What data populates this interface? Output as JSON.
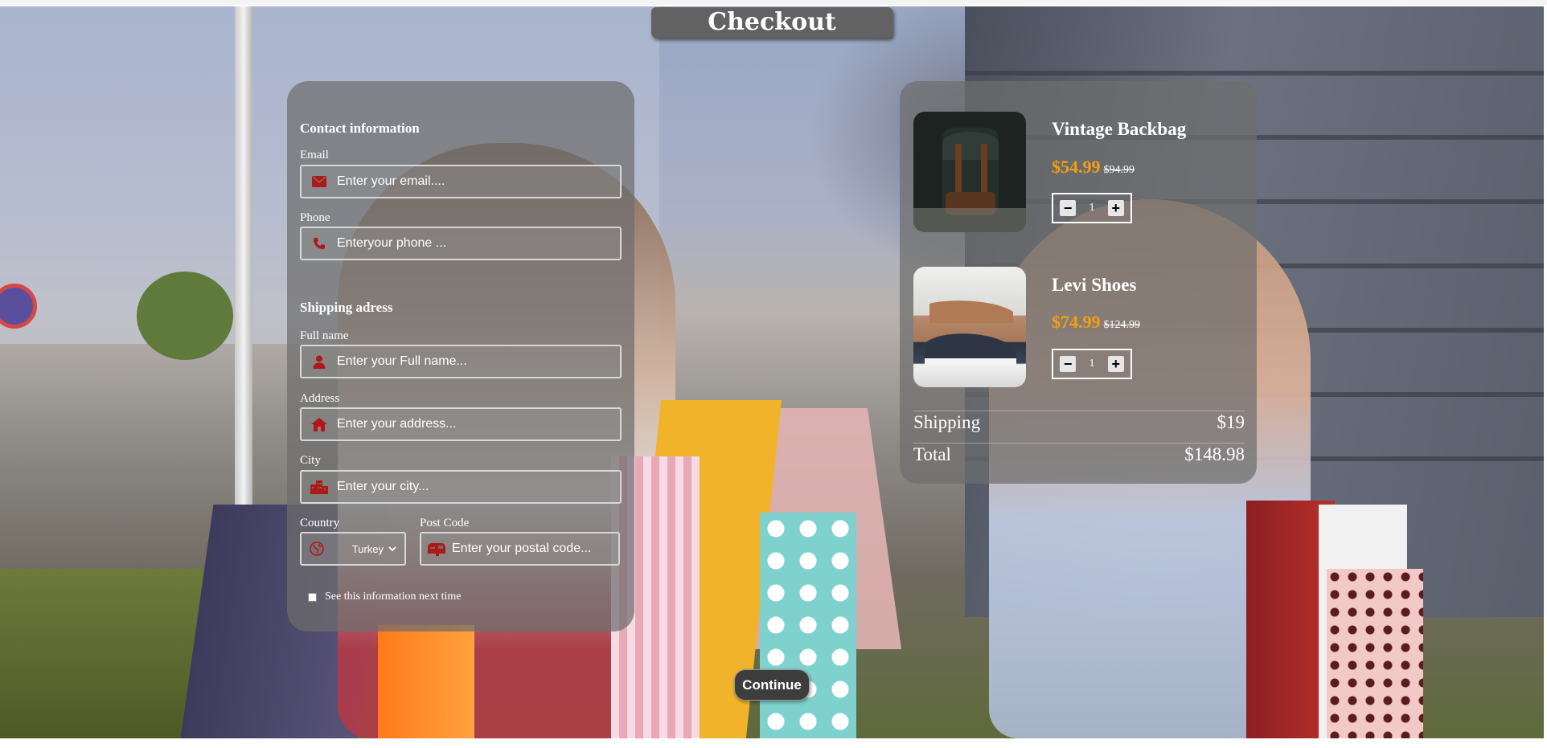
{
  "page": {
    "title": "Checkout"
  },
  "colors": {
    "accent_price": "#f5a00b",
    "icon_red": "#b01818",
    "panel_bg": "#6e6e6e"
  },
  "contact": {
    "heading": "Contact information",
    "email_label": "Email",
    "email_placeholder": "Enter your email....",
    "email_icon": "envelope-icon",
    "phone_label": "Phone",
    "phone_placeholder": "Enteryour phone ...",
    "phone_icon": "phone-icon"
  },
  "shipping": {
    "heading": "Shipping adress",
    "fullname_label": "Full name",
    "fullname_placeholder": "Enter your Full name...",
    "fullname_icon": "user-icon",
    "address_label": "Address",
    "address_placeholder": "Enter your address...",
    "address_icon": "home-icon",
    "city_label": "City",
    "city_placeholder": "Enter your city...",
    "city_icon": "city-icon",
    "country_label": "Country",
    "country_value": "Turkey",
    "country_icon": "globe-icon",
    "postcode_label": "Post Code",
    "postcode_placeholder": "Enter your postal code...",
    "postcode_icon": "mailbox-icon",
    "remember_label": "See this information next time"
  },
  "cart": {
    "items": [
      {
        "name": "Vintage Backbag",
        "price": "$54.99",
        "old_price": "$94.99",
        "qty": "1",
        "image": "backpack-image"
      },
      {
        "name": "Levi Shoes",
        "price": "$74.99",
        "old_price": "$124.99",
        "qty": "1",
        "image": "shoes-image"
      }
    ],
    "minus": "−",
    "plus": "+",
    "shipping_label": "Shipping",
    "shipping_value": "$19",
    "total_label": "Total",
    "total_value": "$148.98"
  },
  "actions": {
    "continue_label": "Continue"
  }
}
